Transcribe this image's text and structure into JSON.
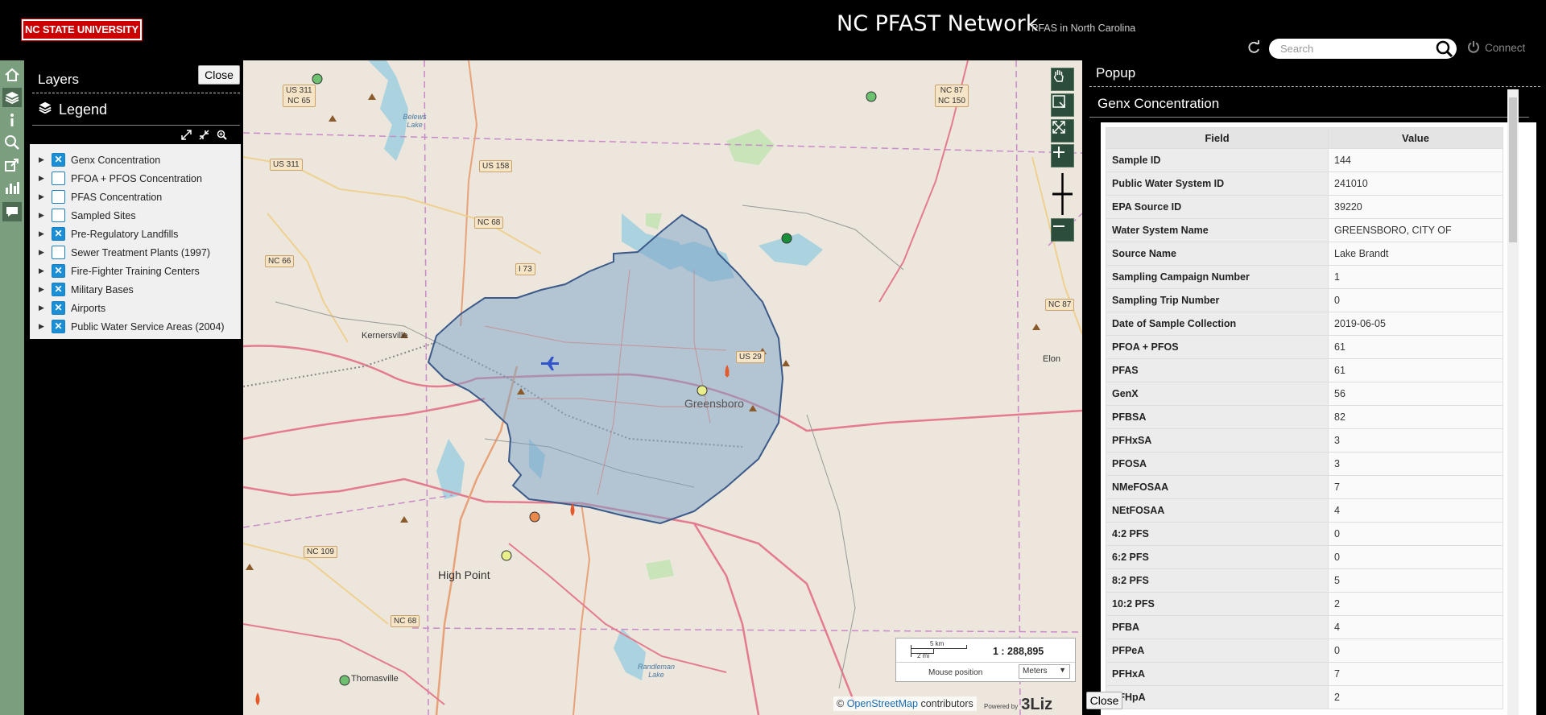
{
  "header": {
    "logo_text": "NC STATE UNIVERSITY",
    "title": "NC PFAST Network",
    "subtitle": "PFAS in North Carolina",
    "search_placeholder": "Search",
    "connect_label": "Connect"
  },
  "left_panel": {
    "layers_title": "Layers",
    "close_label": "Close",
    "legend_title": "Legend",
    "layers": [
      {
        "label": "Genx Concentration",
        "checked": true
      },
      {
        "label": "PFOA + PFOS Concentration",
        "checked": false
      },
      {
        "label": "PFAS Concentration",
        "checked": false
      },
      {
        "label": "Sampled Sites",
        "checked": false
      },
      {
        "label": "Pre-Regulatory Landfills",
        "checked": true
      },
      {
        "label": "Sewer Treatment Plants (1997)",
        "checked": false
      },
      {
        "label": "Fire-Fighter Training Centers",
        "checked": true
      },
      {
        "label": "Military Bases",
        "checked": true
      },
      {
        "label": "Airports",
        "checked": true
      },
      {
        "label": "Public Water Service Areas (2004)",
        "checked": true
      }
    ]
  },
  "map": {
    "place_labels": {
      "greensboro": "Greensboro",
      "high_point": "High Point",
      "kernersville": "Kernersville",
      "thomasville": "Thomasville",
      "elon": "Elon",
      "belews_lake": "Belews Lake",
      "randleman_lake": "Randleman Lake"
    },
    "shields": {
      "us311_nc65": "US 311\nNC 65",
      "us311": "US 311",
      "us158": "US 158",
      "nc68_top": "NC 68",
      "i73": "I 73",
      "nc66": "NC 66",
      "nc87_nc150": "NC 87\nNC 150",
      "nc87": "NC 87",
      "us29": "US 29",
      "nc109": "NC 109",
      "nc68_bottom": "NC 68"
    },
    "scale": {
      "km": "5 km",
      "mi": "2 mi",
      "ratio": "1 : 288,895"
    },
    "mouse_position_label": "Mouse position",
    "units_label": "Meters",
    "attribution_prefix": "©",
    "attribution_link": "OpenStreetMap",
    "attribution_suffix": "contributors",
    "powered_by": "Powered by",
    "lizmap_logo": "3Liz"
  },
  "right_panel": {
    "popup_title": "Popup",
    "feature_title": "Genx Concentration",
    "col_field": "Field",
    "col_value": "Value",
    "rows": [
      {
        "field": "Sample ID",
        "value": "144"
      },
      {
        "field": "Public Water System ID",
        "value": "241010"
      },
      {
        "field": "EPA Source ID",
        "value": "39220"
      },
      {
        "field": "Water System Name",
        "value": "GREENSBORO, CITY OF"
      },
      {
        "field": "Source Name",
        "value": "Lake Brandt"
      },
      {
        "field": "Sampling Campaign Number",
        "value": "1"
      },
      {
        "field": "Sampling Trip Number",
        "value": "0"
      },
      {
        "field": "Date of Sample Collection",
        "value": "2019-06-05"
      },
      {
        "field": "PFOA + PFOS",
        "value": "61"
      },
      {
        "field": "PFAS",
        "value": "61"
      },
      {
        "field": "GenX",
        "value": "56"
      },
      {
        "field": "PFBSA",
        "value": "82"
      },
      {
        "field": "PFHxSA",
        "value": "3"
      },
      {
        "field": "PFOSA",
        "value": "3"
      },
      {
        "field": "NMeFOSAA",
        "value": "7"
      },
      {
        "field": "NEtFOSAA",
        "value": "4"
      },
      {
        "field": "4:2 PFS",
        "value": "0"
      },
      {
        "field": "6:2 PFS",
        "value": "0"
      },
      {
        "field": "8:2 PFS",
        "value": "5"
      },
      {
        "field": "10:2 PFS",
        "value": "2"
      },
      {
        "field": "PFBA",
        "value": "4"
      },
      {
        "field": "PFPeA",
        "value": "0"
      },
      {
        "field": "PFHxA",
        "value": "7"
      },
      {
        "field": "PFHpA",
        "value": "2"
      }
    ],
    "close_label": "Close"
  },
  "colors": {
    "header_bg": "#000000",
    "brand_red": "#cc0000",
    "sidebar_green": "#7a9e7e",
    "checkbox_blue": "#1a8fd6",
    "service_area_fill": "#7aa2c8",
    "service_area_stroke": "#3b5a8a"
  }
}
